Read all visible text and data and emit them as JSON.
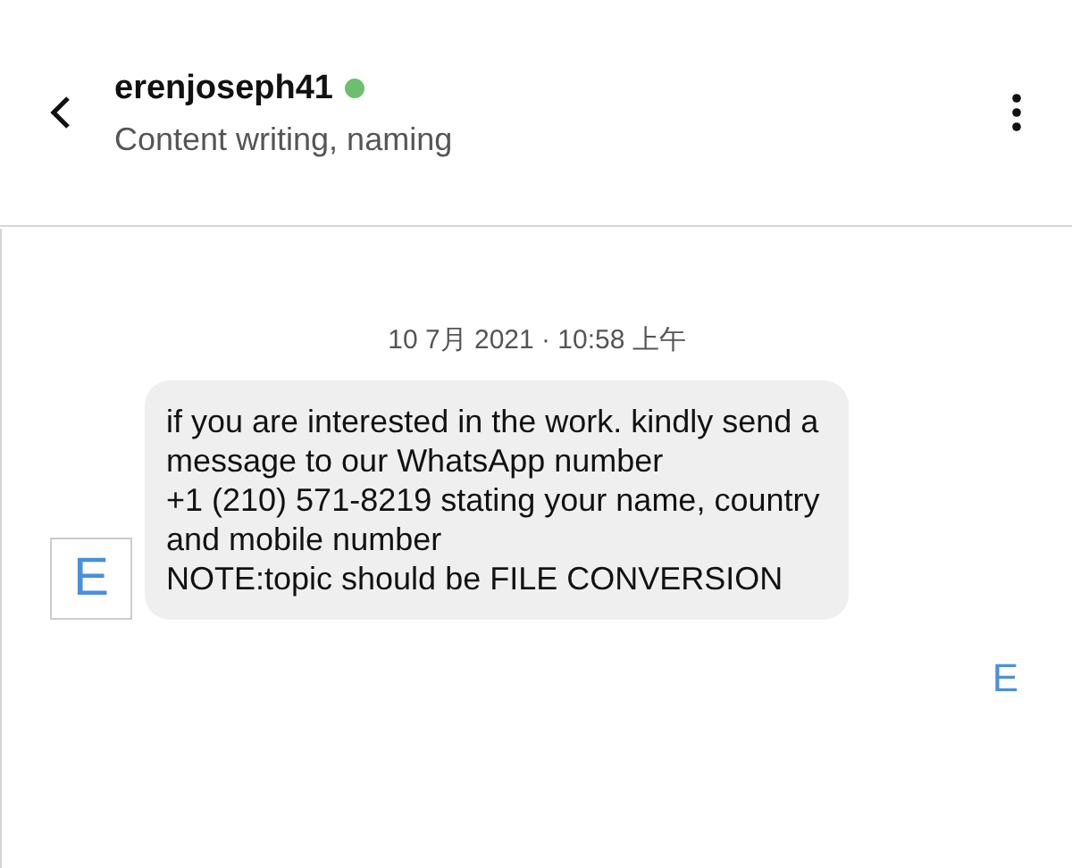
{
  "header": {
    "username": "erenjoseph41",
    "online": true,
    "subtitle": "Content writing, naming"
  },
  "messages": [
    {
      "kind": "received",
      "timestamp": "10 7月 2021 · 10:58 上午",
      "avatar": "E",
      "lines": [
        "if you are interested in the work. kindly send a",
        "message to our WhatsApp number",
        "+1 (210) 571-8219 stating your name, country",
        "and mobile number",
        "NOTE:topic should be FILE CONVERSION"
      ]
    },
    {
      "kind": "sent",
      "avatar": "E"
    }
  ]
}
